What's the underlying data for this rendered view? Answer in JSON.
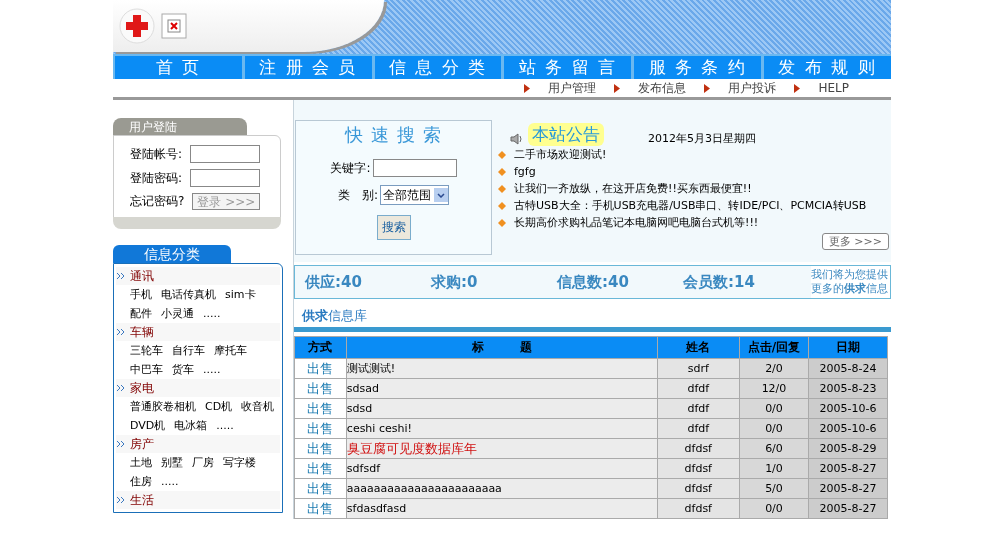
{
  "nav": [
    "首 页",
    "注 册 会 员",
    "信 息 分 类",
    "站 务 留 言",
    "服 务 条 约",
    "发 布 规 则"
  ],
  "subnav": [
    "用户管理",
    "发布信息",
    "用户投诉",
    "HELP"
  ],
  "login": {
    "title": "用户登陆",
    "fields": [
      {
        "label": "登陆帐号:"
      },
      {
        "label": "登陆密码:"
      }
    ],
    "forgot": "忘记密码?",
    "button": "登录 >>>"
  },
  "search": {
    "title": "快 速 搜 索",
    "keyword_label": "关键字:",
    "category_label": "类　别:",
    "category_value": "全部范围",
    "button": "搜索"
  },
  "notice": {
    "title": "本站公告",
    "date": "2012年5月3日星期四",
    "items": [
      "二手市场欢迎测试!",
      "fgfg",
      "让我们一齐放纵，在这开店免费!!买东西最便宜!!",
      "古特USB大全：手机USB充电器/USB串口、转IDE/PCI、PCMCIA转USB",
      "长期高价求购礼品笔记本电脑网吧电脑台式机等!!!"
    ],
    "more": "更多 >>>"
  },
  "stats": [
    "供应:40",
    "求购:0",
    "信息数:40",
    "会员数:14"
  ],
  "promo": [
    "我们将为您提供",
    "更多的**供求**信息"
  ],
  "categories": {
    "title": "信息分类",
    "groups": [
      {
        "name": "通讯",
        "items": [
          "手机",
          "电话传真机",
          "sim卡",
          "配件",
          "小灵通",
          "....."
        ]
      },
      {
        "name": "车辆",
        "items": [
          "三轮车",
          "自行车",
          "摩托车",
          "中巴车",
          "货车",
          "....."
        ]
      },
      {
        "name": "家电",
        "items": [
          "普通胶卷相机",
          "CD机",
          "收音机",
          "DVD机",
          "电冰箱",
          "....."
        ]
      },
      {
        "name": "房产",
        "items": [
          "土地",
          "别墅",
          "厂房",
          "写字楼",
          "住房",
          "....."
        ]
      },
      {
        "name": "生活"
      }
    ]
  },
  "listing": {
    "heading": "**供求**信息库",
    "columns": [
      "方式",
      "标　　　题",
      "姓名",
      "点击/回复",
      "日期"
    ],
    "rows": [
      {
        "type": "出售",
        "title": "测试测试!",
        "hot": false,
        "name": "sdrf",
        "hits": "2/0",
        "date": "2005-8-24"
      },
      {
        "type": "出售",
        "title": "sdsad",
        "hot": false,
        "name": "dfdf",
        "hits": "12/0",
        "date": "2005-8-23"
      },
      {
        "type": "出售",
        "title": "sdsd",
        "hot": false,
        "name": "dfdf",
        "hits": "0/0",
        "date": "2005-10-6"
      },
      {
        "type": "出售",
        "title": "ceshi ceshi!",
        "hot": false,
        "name": "dfdf",
        "hits": "0/0",
        "date": "2005-10-6"
      },
      {
        "type": "出售",
        "title": "臭豆腐可见度数据库年",
        "hot": true,
        "name": "dfdsf",
        "hits": "6/0",
        "date": "2005-8-29"
      },
      {
        "type": "出售",
        "title": "sdfsdf",
        "hot": false,
        "name": "dfdsf",
        "hits": "1/0",
        "date": "2005-8-27"
      },
      {
        "type": "出售",
        "title": "aaaaaaaaaaaaaaaaaaaaaaa",
        "hot": false,
        "name": "dfdsf",
        "hits": "5/0",
        "date": "2005-8-27"
      },
      {
        "type": "出售",
        "title": "sfdasdfasd",
        "hot": false,
        "name": "dfdsf",
        "hits": "0/0",
        "date": "2005-8-27"
      }
    ]
  }
}
